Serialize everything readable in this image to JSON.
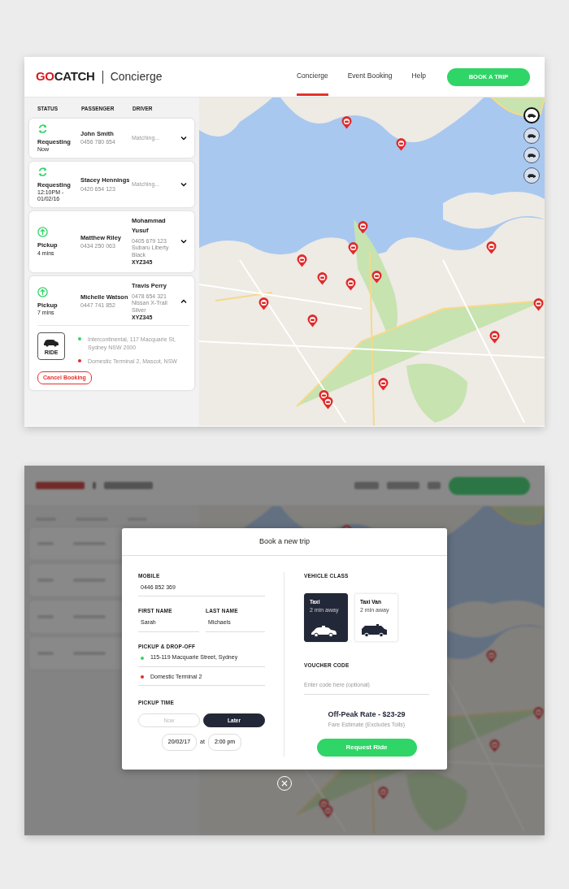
{
  "header": {
    "logo": "GOCATCH",
    "product": "Concierge",
    "nav": [
      {
        "label": "Concierge",
        "selected": true
      },
      {
        "label": "Event Booking",
        "selected": false
      },
      {
        "label": "Help",
        "selected": false
      }
    ],
    "cta": "BOOK A TRIP"
  },
  "columns": [
    "STATUS",
    "PASSENGER",
    "DRIVER"
  ],
  "bookings": [
    {
      "kind": "requesting",
      "status": "Requesting",
      "status_detail": "Now",
      "passenger": "John Smith",
      "phone": "0456 780 654",
      "driver_status": "Matching...",
      "expanded": false
    },
    {
      "kind": "requesting",
      "status": "Requesting",
      "status_detail": "12:10PM - 01/02/16",
      "passenger": "Stacey Hennings",
      "phone": "0420 654 123",
      "driver_status": "Matching...",
      "expanded": false
    },
    {
      "kind": "pickup",
      "status": "Pickup",
      "status_detail": "4 mins",
      "passenger": "Matthew Riley",
      "phone": "0434 250 063",
      "driver": {
        "name": "Mohammad Yusuf",
        "details": [
          "0405 679 123",
          "Subaru Liberty",
          "Black"
        ],
        "plate": "XYZ345"
      },
      "expanded": false
    },
    {
      "kind": "pickup",
      "status": "Pickup",
      "status_detail": "7 mins",
      "passenger": "Michelle Watson",
      "phone": "0447 741 852",
      "driver": {
        "name": "Travis Perry",
        "details": [
          "0478 654 321",
          "Nissan X-Trail",
          "Silver"
        ],
        "plate": "XYZ345"
      },
      "expanded": true,
      "vehicle_label": "RIDE",
      "pickup": "Intercontinental, 117 Macquarie St, Sydney NSW 2000",
      "dropoff": "Domestic Terminal 2, Mascot, NSW",
      "cancel": "Cancel Booking"
    }
  ],
  "map": {
    "vehicle_filters": [
      {
        "selected": true
      },
      {
        "selected": false
      },
      {
        "selected": false
      },
      {
        "selected": false
      }
    ]
  },
  "modal": {
    "title": "Book a new trip",
    "mobile": {
      "label": "MOBILE",
      "value": "0446 852 369"
    },
    "first_name": {
      "label": "FIRST NAME",
      "value": "Sarah"
    },
    "last_name": {
      "label": "LAST NAME",
      "value": "Michaels"
    },
    "route": {
      "label": "PICKUP & DROP-OFF",
      "pickup": "115-119 Macquarie Street, Sydney",
      "dropoff": "Domestic Terminal 2"
    },
    "pickup_time": {
      "label": "PICKUP TIME",
      "options": [
        {
          "label": "Now",
          "selected": false
        },
        {
          "label": "Later",
          "selected": true
        }
      ],
      "date": "20/02/17",
      "at": "at",
      "time": "2:00 pm"
    },
    "vehicle_class": {
      "label": "VEHICLE CLASS",
      "options": [
        {
          "kind": "taxi",
          "name": "Taxi",
          "eta": "2 min away",
          "selected": true
        },
        {
          "kind": "van",
          "name": "Taxi Van",
          "eta": "2 min away",
          "selected": false
        }
      ]
    },
    "voucher": {
      "label": "VOUCHER CODE",
      "placeholder": "Enter code here (optional)"
    },
    "rate": "Off-Peak Rate - $23-29",
    "rate_note": "Fare Estimate (Excludes Tolls)",
    "submit": "Request Ride"
  }
}
